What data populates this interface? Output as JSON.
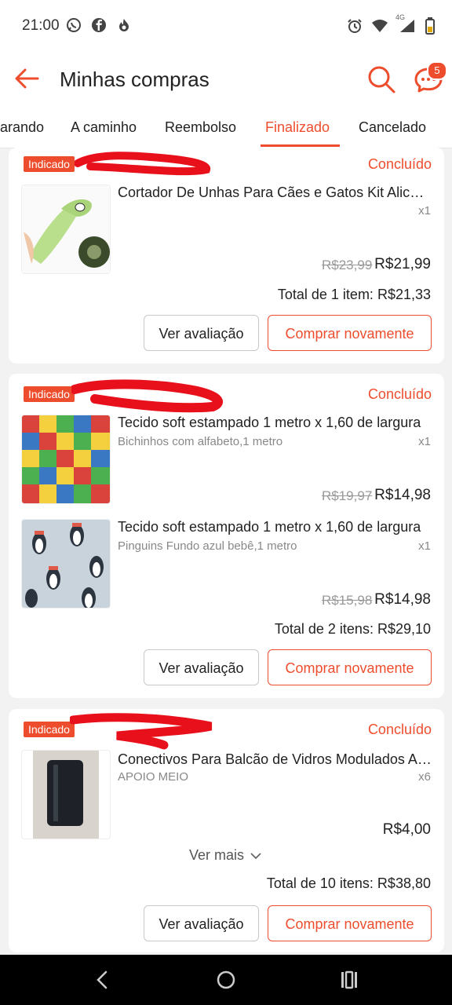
{
  "status_bar": {
    "time": "21:00",
    "left_icons": [
      "whatsapp-icon",
      "facebook-icon",
      "flame-icon"
    ],
    "right_icons": [
      "alarm-icon",
      "wifi-icon",
      "signal-4g-icon",
      "battery-icon"
    ],
    "network_label": "4G"
  },
  "app_bar": {
    "title": "Minhas compras",
    "chat_badge": "5"
  },
  "tabs": [
    {
      "label": "arando",
      "active": false
    },
    {
      "label": "A caminho",
      "active": false
    },
    {
      "label": "Reembolso",
      "active": false
    },
    {
      "label": "Finalizado",
      "active": true
    },
    {
      "label": "Cancelado",
      "active": false
    }
  ],
  "orders": [
    {
      "badge": "Indicado",
      "status": "Concluído",
      "items": [
        {
          "name": "Cortador De Unhas Para Cães e Gatos Kit Alicate...",
          "variant": "",
          "qty": "x1",
          "old_price": "R$23,99",
          "price": "R$21,99"
        }
      ],
      "total": "Total de 1 item: R$21,33",
      "btn_review": "Ver avaliação",
      "btn_buy": "Comprar novamente"
    },
    {
      "badge": "Indicado",
      "status": "Concluído",
      "items": [
        {
          "name": "Tecido soft estampado 1 metro x 1,60 de largura",
          "variant": "Bichinhos com alfabeto,1 metro",
          "qty": "x1",
          "old_price": "R$19,97",
          "price": "R$14,98"
        },
        {
          "name": "Tecido soft estampado 1 metro x 1,60 de largura",
          "variant": "Pinguins Fundo azul bebê,1 metro",
          "qty": "x1",
          "old_price": "R$15,98",
          "price": "R$14,98"
        }
      ],
      "total": "Total de 2 itens: R$29,10",
      "btn_review": "Ver avaliação",
      "btn_buy": "Comprar novamente"
    },
    {
      "badge": "Indicado",
      "status": "Concluído",
      "items": [
        {
          "name": "Conectivos Para Balcão de Vidros Modulados Apoio",
          "variant": "APOIO MEIO",
          "qty": "x6",
          "old_price": "",
          "price": "R$4,00"
        }
      ],
      "see_more": "Ver mais",
      "total": "Total de 10 itens: R$38,80",
      "btn_review": "Ver avaliação",
      "btn_buy": "Comprar novamente"
    }
  ],
  "colors": {
    "accent": "#ee4d2d",
    "background": "#f2f2f2",
    "redaction": "#e8101a"
  }
}
